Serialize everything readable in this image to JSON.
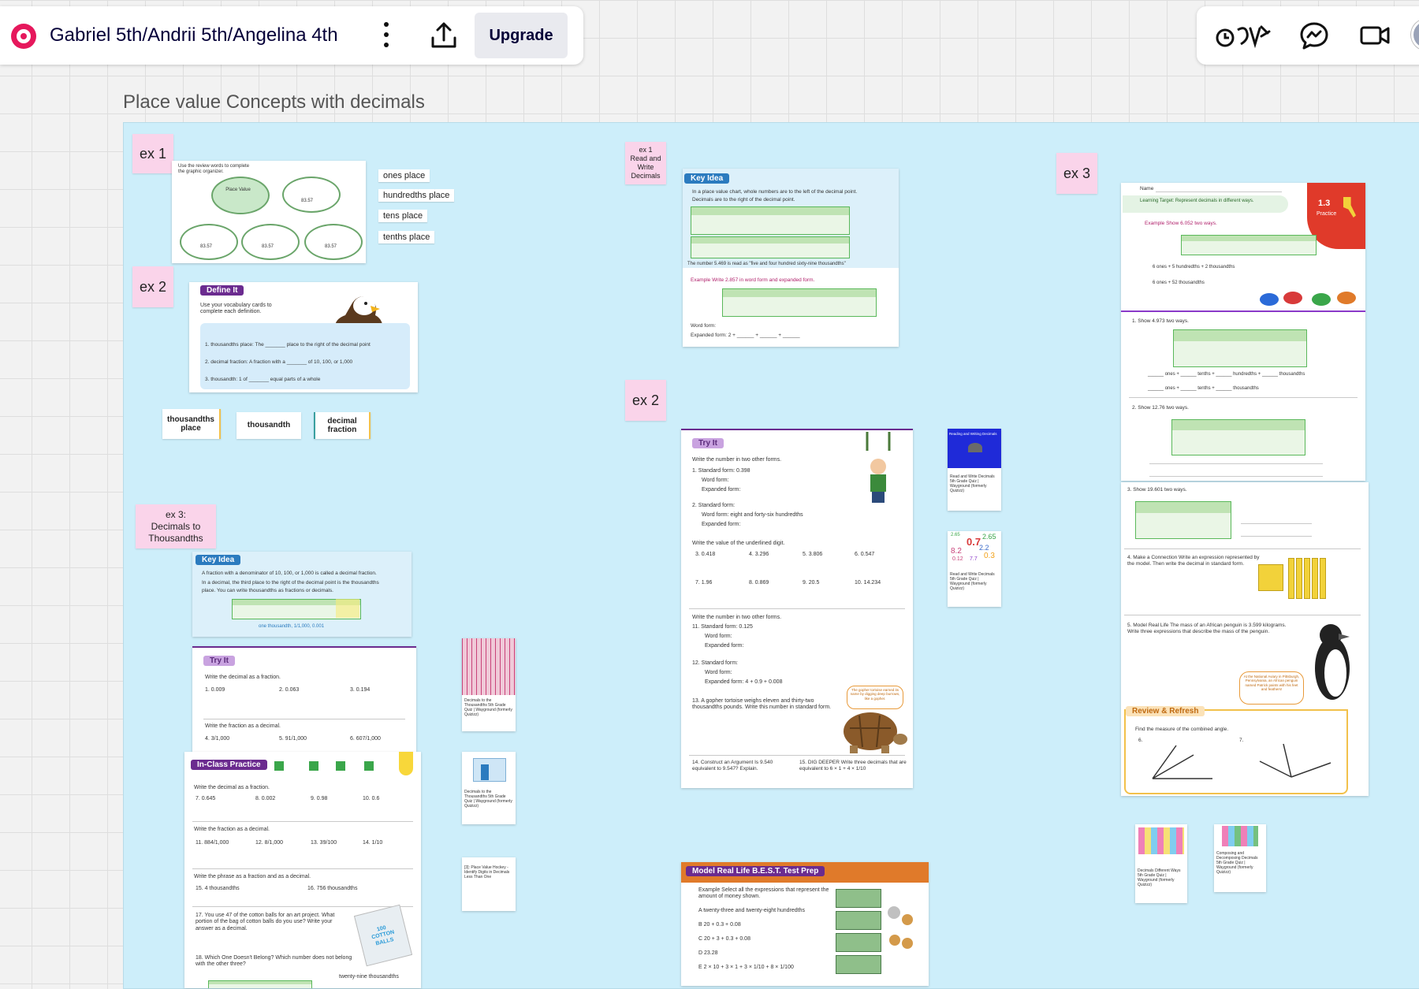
{
  "board": {
    "title": "Gabriel 5th/Andrii 5th/Angelina 4th",
    "upgrade_label": "Upgrade",
    "frame_title": "Place value Concepts with decimals"
  },
  "toolbar_right": {
    "icons": [
      "reactions-icon",
      "comments-icon",
      "video-call-icon"
    ]
  },
  "stickies": {
    "ex1_left": "ex 1",
    "ex2_left": "ex 2",
    "ex3_left": "ex 3:\nDecimals to\nThousandths",
    "ex1_mid": "ex 1\nRead and\nWrite\nDecimals",
    "ex2_mid": "ex 2",
    "ex3_right": "ex 3"
  },
  "vocab_tags": [
    "ones place",
    "hundredths place",
    "tens place",
    "tenths place"
  ],
  "word_cards": [
    "thousandths place",
    "thousandth",
    "decimal fraction"
  ],
  "organizer": {
    "intro": "Use the review words to complete the graphic organizer.",
    "center": "Place Value",
    "values": [
      "83.57",
      "83.57",
      "83.57",
      "83.57"
    ]
  },
  "define_it": {
    "header": "Define It",
    "intro": "Use your vocabulary cards to complete each definition.",
    "items": [
      "1.  thousandths place: The _______ place to the right of the decimal point",
      "2.  decimal fraction: A fraction with a _______ of 10, 100, or 1,000",
      "3.  thousandth: 1 of _______ equal parts of a whole"
    ]
  },
  "key_idea_left": {
    "header": "Key Idea",
    "line1": "A fraction with a denominator of 10, 100, or 1,000 is called a decimal fraction.",
    "line2": "In a decimal, the third place to the right of the decimal point is the thousandths",
    "line3": "place. You can write thousandths as fractions or decimals.",
    "footnote": "one thousandth, 1/1,000, 0.001"
  },
  "try_it_left": {
    "header": "Try It",
    "prompt1": "Write the decimal as a fraction.",
    "items1": [
      "1.  0.009",
      "2.  0.063",
      "3.  0.194"
    ],
    "prompt2": "Write the fraction as a decimal.",
    "items2": [
      "4.  3/1,000",
      "5.  91/1,000",
      "6.  607/1,000"
    ]
  },
  "in_class": {
    "header": "In-Class Practice",
    "prompt1": "Write the decimal as a fraction.",
    "items1": [
      "7.  0.645",
      "8.  0.002",
      "9.  0.98",
      "10.  0.6"
    ],
    "prompt2": "Write the fraction as a decimal.",
    "items2": [
      "11.  884/1,000",
      "12.  8/1,000",
      "13.  39/100",
      "14.  1/10"
    ],
    "prompt3": "Write the phrase as a fraction and as a decimal.",
    "items3": [
      "15.  4 thousandths",
      "16.  756 thousandths"
    ],
    "q17": "17.  You use 47 of the cotton balls for an art project. What portion of the bag of cotton balls do you use? Write your answer as a decimal.",
    "q18": "18.  Which One Doesn't Belong? Which number does not belong with the other three?",
    "q18_extra": "twenty-nine thousandths",
    "bag_label": "100 COTTON BALLS"
  },
  "key_idea_mid": {
    "header": "Key Idea",
    "line1": "In a place value chart, whole numbers are to the left of the decimal point.",
    "line2": "Decimals are to the right of the decimal point.",
    "read_as": "The number 5.469 is read as \"five and four hundred sixty-nine thousandths\"",
    "example": "Example   Write 2.857 in word form and expanded form.",
    "word_form": "Word form:",
    "expanded_form": "Expanded form: 2 + ______ + ______ + ______"
  },
  "try_it_mid": {
    "header": "Try It",
    "prompt": "Write the number in two other forms.",
    "q1": "1.  Standard form: 0.398",
    "word_form": "Word form:",
    "expanded_form": "Expanded form:",
    "q2": "2.  Standard form:",
    "q2_word": "Word form: eight and forty-six hundredths",
    "underlined_prompt": "Write the value of the underlined digit.",
    "digits1": [
      "3.  0.418",
      "4.  3.296",
      "5.  3.806",
      "6.  0.547"
    ],
    "digits2": [
      "7.  1.96",
      "8.  0.869",
      "9.  20.5",
      "10.  14.234"
    ],
    "prompt2": "Write the number in two other forms.",
    "q11": "11.  Standard form: 0.125",
    "q12": "12.  Standard form:",
    "q12_expanded": "Expanded form: 4 + 0.9 + 0.008",
    "q13": "13.  A gopher tortoise weighs eleven and thirty-two thousandths pounds. Write this number in standard form.",
    "q14": "14.  Construct an Argument  Is 9.540 equivalent to 9.547? Explain.",
    "q15": "15.  DIG DEEPER  Write three decimals that are equivalent to 6 × 1 + 4 × 1/10",
    "bubble": "The gopher tortoise earned its name by digging deep burrows, like a gopher."
  },
  "model_real_life": {
    "header": "Model Real Life  B.E.S.T. Test Prep",
    "example": "Example   Select all the expressions that represent the amount of money shown.",
    "options": [
      "A   twenty-three and twenty-eight hundredths",
      "B   20 + 0.3 + 0.08",
      "C   20 + 3 + 0.3 + 0.08",
      "D   23.28",
      "E   2 × 10 + 3 × 1 + 3 × 1/10 + 8 × 1/100"
    ]
  },
  "practice": {
    "name_label": "Name",
    "badge": "1.3",
    "badge_sub": "Practice",
    "learning_target": "Learning Target: Represent decimals in different ways.",
    "example": "Example   Show 6.052 two ways.",
    "ones_line": "6  ones + 5  hundredths + 2  thousandths",
    "thousandths_line": "6  ones + 52  thousandths",
    "q1": "1.  Show 4.973 two ways.",
    "q1_line1": "______ ones + ______ tenths + ______ hundredths + ______ thousandths",
    "q1_line2": "______ ones + ______ tenths + ______ thousandths",
    "q2": "2.  Show 12.76 two ways.",
    "q3": "3.  Show 19.601 two ways.",
    "q4": "4.  Make a Connection  Write an expression represented by the model. Then write the decimal in standard form.",
    "q5": "5.  Model Real Life  The mass of an African penguin is 3.599 kilograms. Write three expressions that describe the mass of the penguin.",
    "penguin_note": "At the National Aviary in Pittsburgh, Pennsylvania, an African penguin named Patrick paints with his feet and feathers!",
    "review": "Review & Refresh",
    "angle_prompt": "Find the measure of the combined angle.",
    "angle_items": [
      "6.",
      "7."
    ]
  },
  "quiz_cards": [
    {
      "title": "Reading and Writing Decimals",
      "caption": "Read and Write Decimals 5th Grade Quiz | Wayground (formerly Quizizz)"
    },
    {
      "title": "",
      "caption": "Read and Write Decimals 5th Grade Quiz | Wayground (formerly Quizizz)"
    },
    {
      "title": "",
      "caption": "Decimals to the Thousandths 5th Grade Quiz | Wayground (formerly Quizizz)"
    },
    {
      "title": "",
      "caption": "Decimals to the Thousandths 5th Grade Quiz | Wayground (formerly Quizizz)"
    },
    {
      "title": "",
      "caption": "[3]: Place Value Hockey - Identify Digits in Decimals Less Than One"
    },
    {
      "title": "",
      "caption": "Decimals Different Ways 5th Grade Quiz | Wayground (formerly Quizizz)"
    },
    {
      "title": "",
      "caption": "Composing and Decomposing Decimals 5th Grade Quiz | Wayground (formerly Quizizz)"
    }
  ],
  "decimal_cloud": [
    "2.65",
    "0.7",
    "8.2",
    "2.2",
    "0.3",
    "0.12",
    "7.7"
  ]
}
